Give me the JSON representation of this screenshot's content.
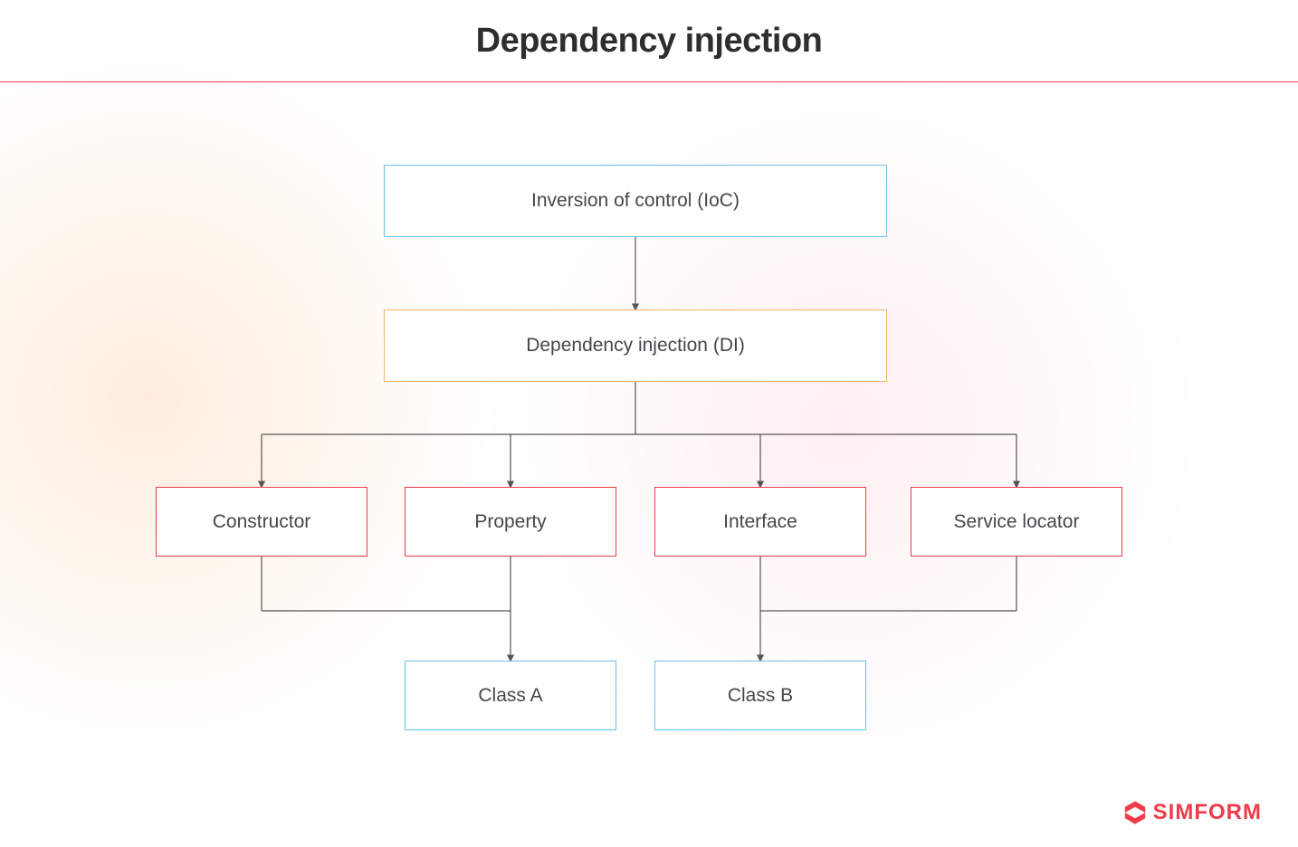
{
  "title": "Dependency injection",
  "nodes": {
    "ioc": "Inversion of control (IoC)",
    "di": "Dependency injection (DI)",
    "constructor": "Constructor",
    "property": "Property",
    "interface": "Interface",
    "service_locator": "Service locator",
    "class_a": "Class A",
    "class_b": "Class B"
  },
  "branding": {
    "name": "SIMFORM"
  },
  "colors": {
    "accent_red": "#ef3b4a",
    "accent_blue": "#6cc2e8",
    "accent_orange": "#f5b26b",
    "text": "#44474a"
  },
  "diagram_structure": {
    "root": "ioc",
    "edges": [
      [
        "ioc",
        "di"
      ],
      [
        "di",
        "constructor"
      ],
      [
        "di",
        "property"
      ],
      [
        "di",
        "interface"
      ],
      [
        "di",
        "service_locator"
      ],
      [
        "constructor",
        "class_a"
      ],
      [
        "property",
        "class_a"
      ],
      [
        "interface",
        "class_b"
      ],
      [
        "service_locator",
        "class_b"
      ]
    ]
  }
}
